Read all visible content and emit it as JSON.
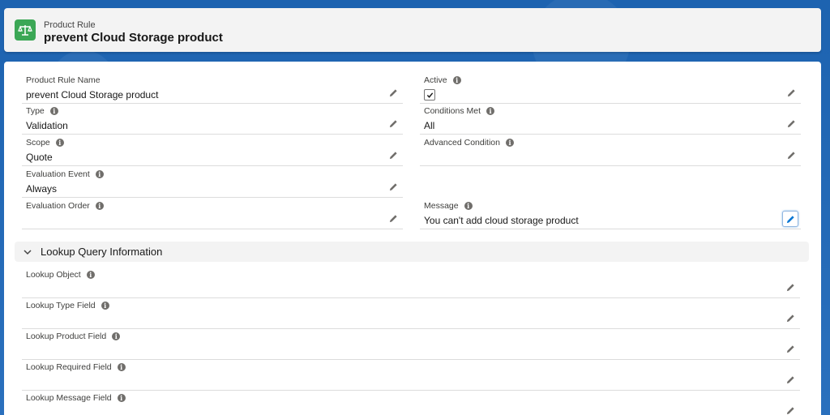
{
  "header": {
    "object_type": "Product Rule",
    "title": "prevent Cloud Storage product"
  },
  "fields_left": [
    {
      "label": "Product Rule Name",
      "value": "prevent Cloud Storage product",
      "info": false
    },
    {
      "label": "Type",
      "value": "Validation",
      "info": true
    },
    {
      "label": "Scope",
      "value": "Quote",
      "info": true
    },
    {
      "label": "Evaluation Event",
      "value": "Always",
      "info": true
    },
    {
      "label": "Evaluation Order",
      "value": "",
      "info": true
    }
  ],
  "fields_right": [
    {
      "label": "Active",
      "checked": true,
      "info": true
    },
    {
      "label": "Conditions Met",
      "value": "All",
      "info": true
    },
    {
      "label": "Advanced Condition",
      "value": "",
      "info": true
    },
    {
      "label": "Message",
      "value": "You can't add cloud storage product",
      "info": true
    }
  ],
  "lookup_section": {
    "title": "Lookup Query Information",
    "fields": [
      {
        "label": "Lookup Object",
        "value": ""
      },
      {
        "label": "Lookup Type Field",
        "value": ""
      },
      {
        "label": "Lookup Product Field",
        "value": ""
      },
      {
        "label": "Lookup Required Field",
        "value": ""
      },
      {
        "label": "Lookup Message Field",
        "value": ""
      }
    ]
  },
  "icons": {
    "app": "scales-icon",
    "edit": "pencil-icon",
    "info": "info-icon",
    "collapse": "chevron-down-icon",
    "check": "checkmark-icon"
  },
  "colors": {
    "app_icon_bg": "#3ba755",
    "background": "#1b5fa8",
    "focus": "#0176d3"
  }
}
